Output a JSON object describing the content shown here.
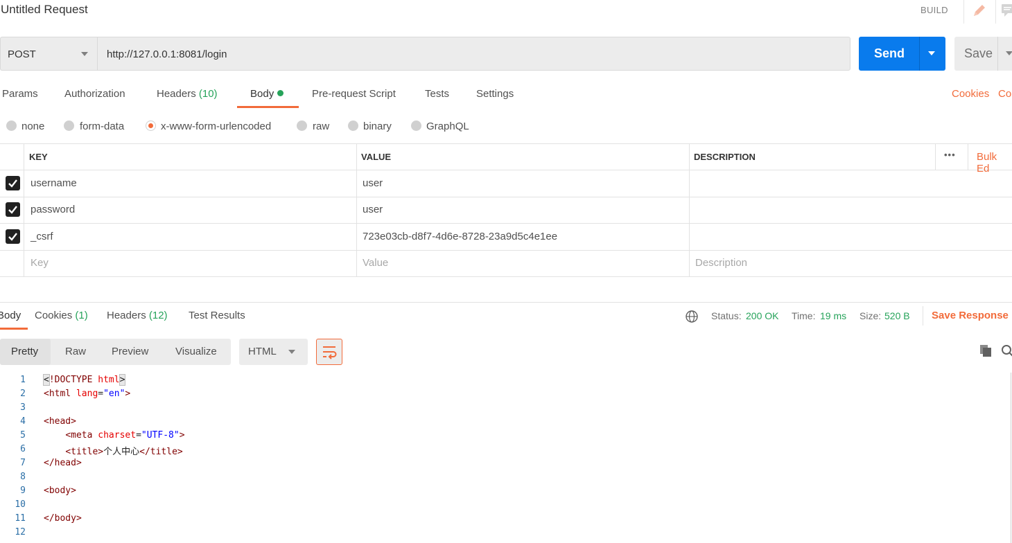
{
  "header": {
    "title": "Untitled Request",
    "build_label": "BUILD"
  },
  "request": {
    "method": "POST",
    "url": "http://127.0.0.1:8081/login",
    "send_label": "Send",
    "save_label": "Save"
  },
  "req_tabs": [
    {
      "label": "Params"
    },
    {
      "label": "Authorization"
    },
    {
      "label": "Headers",
      "count": "(10)"
    },
    {
      "label": "Body",
      "active": true
    },
    {
      "label": "Pre-request Script"
    },
    {
      "label": "Tests"
    },
    {
      "label": "Settings"
    }
  ],
  "req_links": {
    "cookies": "Cookies",
    "code": "Co"
  },
  "body_types": [
    {
      "label": "none"
    },
    {
      "label": "form-data"
    },
    {
      "label": "x-www-form-urlencoded",
      "selected": true
    },
    {
      "label": "raw"
    },
    {
      "label": "binary"
    },
    {
      "label": "GraphQL"
    }
  ],
  "table": {
    "headers": {
      "key": "KEY",
      "value": "VALUE",
      "description": "DESCRIPTION",
      "more": "•••",
      "bulk_edit": "Bulk Ed"
    },
    "rows": [
      {
        "key": "username",
        "value": "user",
        "checked": true
      },
      {
        "key": "password",
        "value": "user",
        "checked": true
      },
      {
        "key": "_csrf",
        "value": "723e03cb-d8f7-4d6e-8728-23a9d5c4e1ee",
        "checked": true
      }
    ],
    "placeholders": {
      "key": "Key",
      "value": "Value",
      "description": "Description"
    }
  },
  "response": {
    "tabs": [
      {
        "label": "Body",
        "active": true
      },
      {
        "label": "Cookies",
        "count": "(1)"
      },
      {
        "label": "Headers",
        "count": "(12)"
      },
      {
        "label": "Test Results"
      }
    ],
    "status_label": "Status:",
    "status_value": "200 OK",
    "time_label": "Time:",
    "time_value": "19 ms",
    "size_label": "Size:",
    "size_value": "520 B",
    "save_response": "Save Response",
    "formats": [
      "Pretty",
      "Raw",
      "Preview",
      "Visualize"
    ],
    "language": "HTML"
  },
  "code": {
    "line_numbers": [
      "1",
      "2",
      "3",
      "4",
      "5",
      "6",
      "7",
      "8",
      "9",
      "10",
      "11",
      "12"
    ],
    "doctype": "!DOCTYPE",
    "html_kw": "html",
    "html_open": "<html",
    "lang_attr": "lang",
    "lang_val": "\"en\"",
    "head_open": "<head>",
    "meta_open": "<meta",
    "charset_attr": "charset",
    "charset_val": "\"UTF-8\"",
    "title_open": "<title>",
    "title_text": "个人中心",
    "title_close": "</title>",
    "head_close": "</head>",
    "body_open": "<body>",
    "body_close": "</body>"
  },
  "colors": {
    "accent": "#f26b3a",
    "send": "#097bed",
    "success": "#26a35a"
  }
}
